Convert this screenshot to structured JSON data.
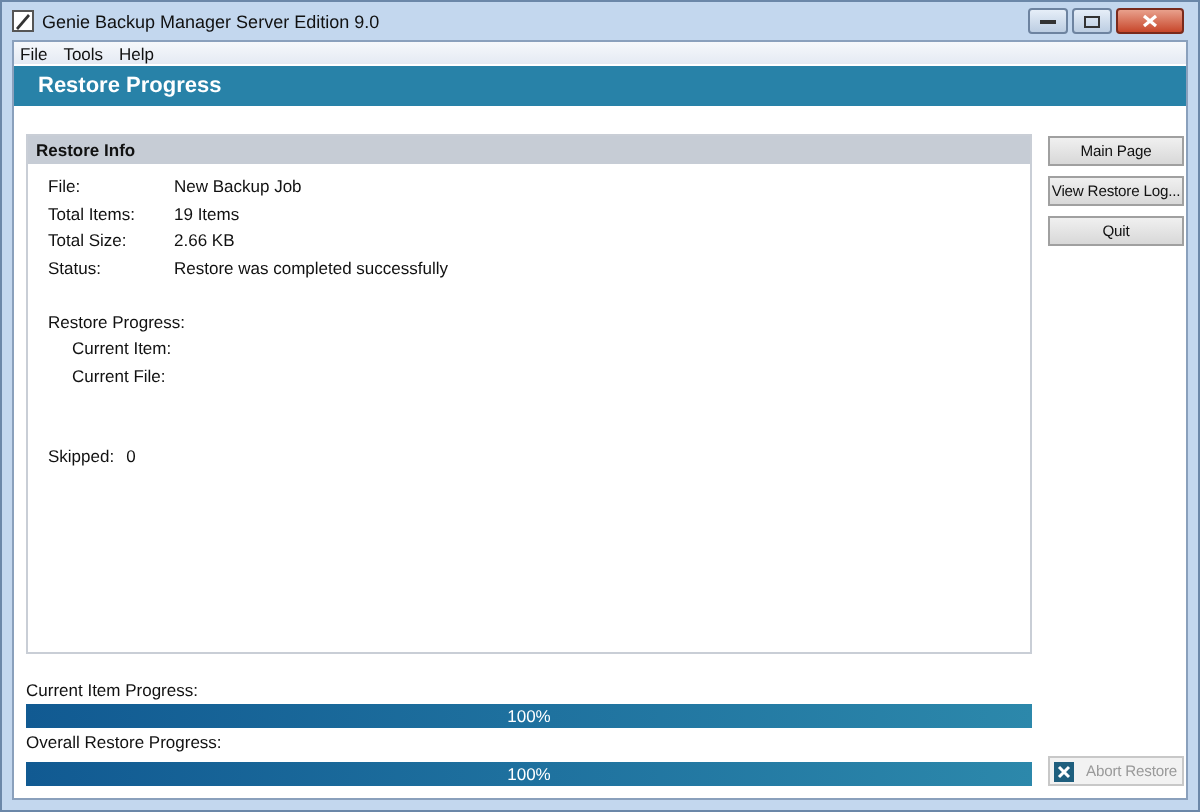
{
  "window": {
    "title": "Genie Backup Manager Server Edition 9.0"
  },
  "menu": [
    "File",
    "Tools",
    "Help"
  ],
  "header": {
    "title": "Restore Progress"
  },
  "restore_info": {
    "title": "Restore Info",
    "fields": [
      {
        "label": "File:",
        "value": "New Backup Job"
      },
      {
        "label": "Total Items:",
        "value": "19 Items"
      },
      {
        "label": "Total Size:",
        "value": "2.66 KB"
      },
      {
        "label": "Status:",
        "value": "Restore was completed successfully"
      }
    ],
    "progress_title": "Restore Progress:",
    "progress_fields": [
      {
        "label": "Current Item:"
      },
      {
        "label": "Current File:"
      }
    ],
    "skipped": {
      "label": "Skipped:",
      "value": "0"
    }
  },
  "side_buttons": [
    {
      "label": "Main Page",
      "disabled": false
    },
    {
      "label": "View Restore Log...",
      "disabled": false
    },
    {
      "label": "Quit",
      "disabled": false
    }
  ],
  "progress_bars": [
    {
      "label": "Current Item Progress:",
      "level": 1,
      "reading": "100%"
    },
    {
      "label": "Overall Restore Progress:",
      "level": 1,
      "reading": "100%"
    }
  ],
  "abort_button": {
    "label": "Abort Restore",
    "disabled": true
  }
}
